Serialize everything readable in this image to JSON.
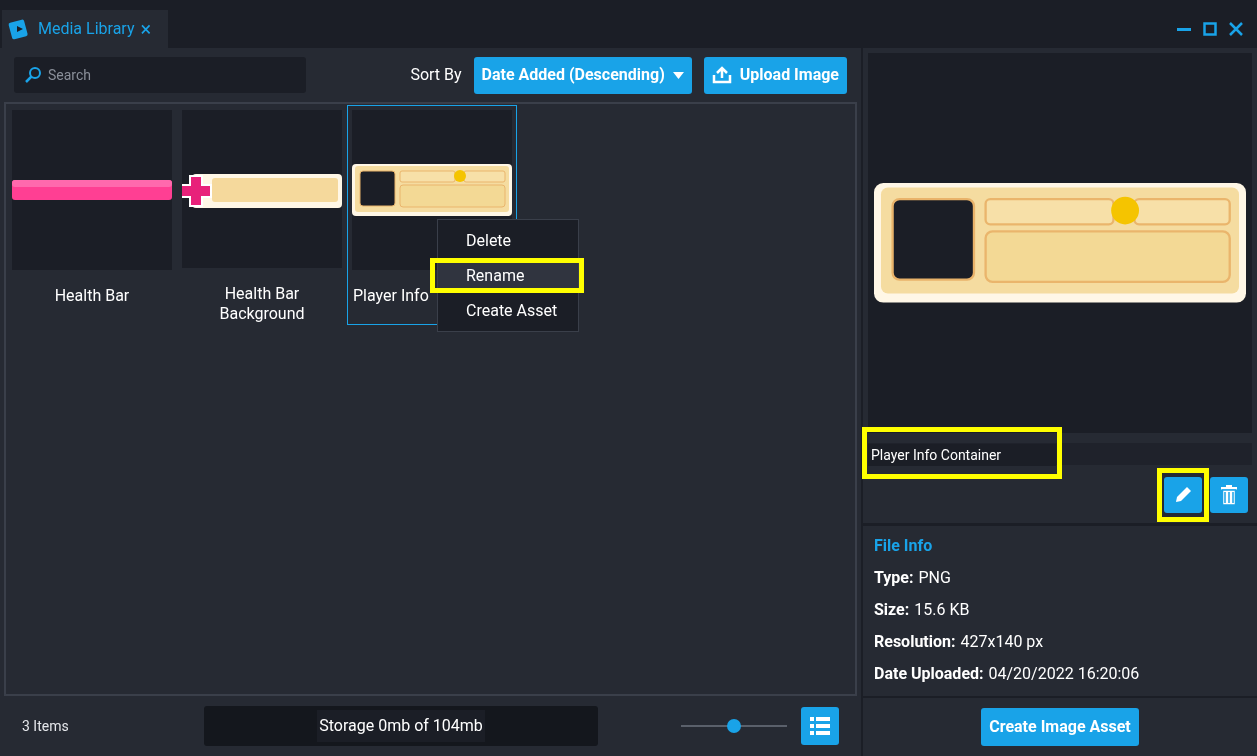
{
  "window": {
    "tab_title": "Media Library",
    "tab_close": "×"
  },
  "toolbar": {
    "search": {
      "placeholder": "Search"
    },
    "sort_label": "Sort By",
    "sort_value": "Date Added (Descending)",
    "upload_button": "Upload Image"
  },
  "items": [
    {
      "name": "Health Bar",
      "kind": "bar",
      "selected": false
    },
    {
      "name": "Health Bar Background",
      "kind": "background",
      "selected": false
    },
    {
      "name": "Player Info",
      "kind": "panel",
      "selected": true
    }
  ],
  "context_menu": [
    {
      "label": "Delete",
      "highlighted": false
    },
    {
      "label": "Rename",
      "highlighted": true
    },
    {
      "label": "Create Asset",
      "highlighted": false
    }
  ],
  "footer": {
    "count": "3 Items",
    "storage": "Storage 0mb of 104mb",
    "zoom": {
      "level": 0.5
    }
  },
  "details": {
    "name_field": {
      "value": "Player Info Container",
      "highlighted": true
    },
    "edit_highlighted": true,
    "file_info_title": "File Info",
    "fields": [
      {
        "label": "Type:",
        "value": "PNG"
      },
      {
        "label": "Size:",
        "value": "15.6 KB"
      },
      {
        "label": "Resolution:",
        "value": "427x140 px"
      },
      {
        "label": "Date Uploaded:",
        "value": "04/20/2022 16:20:06"
      }
    ],
    "create_button": "Create Image Asset"
  }
}
